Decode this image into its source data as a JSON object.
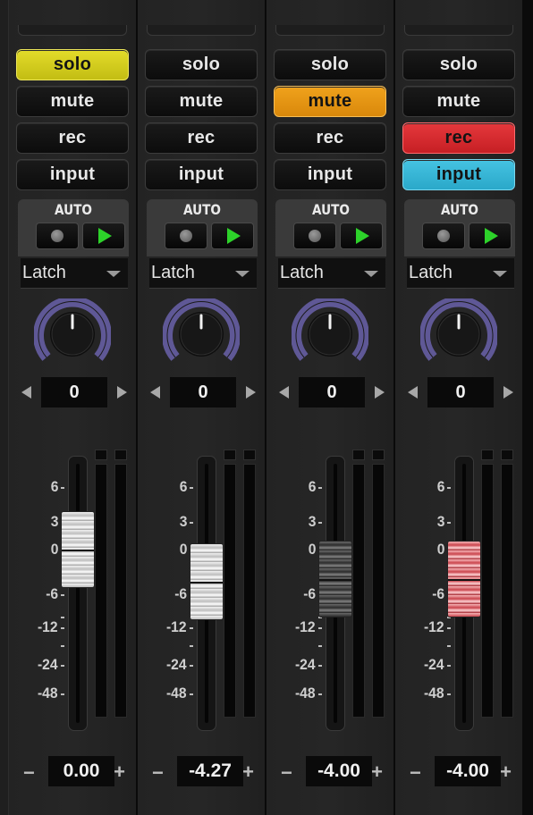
{
  "colors": {
    "solo_active": "#d9d31f",
    "mute_active": "#e6960f",
    "rec_active": "#d92c31",
    "input_active": "#37b6d6",
    "knob_ring": "#5f5896",
    "play_green": "#2dd22a"
  },
  "scale_labels": [
    "6",
    "3",
    "0",
    "-6",
    "-12",
    "-24",
    "-48"
  ],
  "strips": [
    {
      "solo": "solo",
      "mute": "mute",
      "rec": "rec",
      "input": "input",
      "active": "solo",
      "auto_label": "AUTO",
      "mode": "Latch",
      "pan": "0",
      "volume": "0.00",
      "volume_db": 0.0,
      "fader_style": "silver",
      "minus": "−",
      "plus": "+"
    },
    {
      "solo": "solo",
      "mute": "mute",
      "rec": "rec",
      "input": "input",
      "active": "none",
      "auto_label": "AUTO",
      "mode": "Latch",
      "pan": "0",
      "volume": "-4.27",
      "volume_db": -4.27,
      "fader_style": "silver",
      "minus": "−",
      "plus": "+"
    },
    {
      "solo": "solo",
      "mute": "mute",
      "rec": "rec",
      "input": "input",
      "active": "mute",
      "auto_label": "AUTO",
      "mode": "Latch",
      "pan": "0",
      "volume": "-4.00",
      "volume_db": -4.0,
      "fader_style": "dark",
      "minus": "−",
      "plus": "+"
    },
    {
      "solo": "solo",
      "mute": "mute",
      "rec": "rec",
      "input": "input",
      "active": "rec,input",
      "auto_label": "AUTO",
      "mode": "Latch",
      "pan": "0",
      "volume": "-4.00",
      "volume_db": -4.0,
      "fader_style": "red",
      "minus": "−",
      "plus": "+"
    }
  ]
}
